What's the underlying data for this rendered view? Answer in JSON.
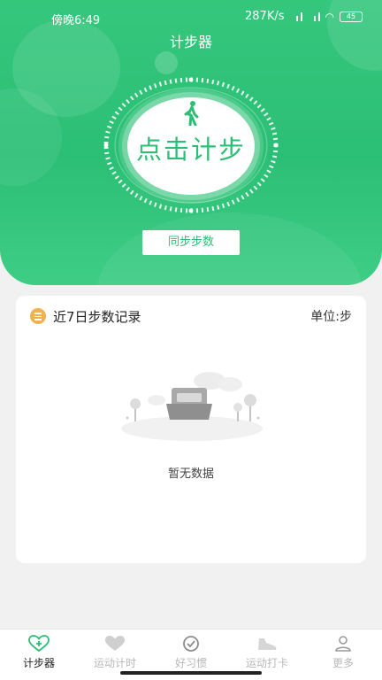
{
  "status_bar": {
    "time": "傍晚6:49",
    "network_speed": "287K/s",
    "battery": "45"
  },
  "header": {
    "title": "计步器"
  },
  "hero": {
    "step_button_label": "点击计步",
    "sync_button_label": "同步步数"
  },
  "record_card": {
    "title": "近7日步数记录",
    "unit": "单位:步",
    "empty_text": "暂无数据"
  },
  "tabbar": {
    "items": [
      {
        "label": "计步器",
        "icon": "heart-plus-icon",
        "active": true
      },
      {
        "label": "运动计时",
        "icon": "heart-icon",
        "active": false
      },
      {
        "label": "好习惯",
        "icon": "check-badge-icon",
        "active": false
      },
      {
        "label": "运动打卡",
        "icon": "shoe-icon",
        "active": false
      },
      {
        "label": "更多",
        "icon": "person-icon",
        "active": false
      }
    ]
  },
  "colors": {
    "accent": "#2bbf75",
    "card_icon": "#f0b14f"
  }
}
